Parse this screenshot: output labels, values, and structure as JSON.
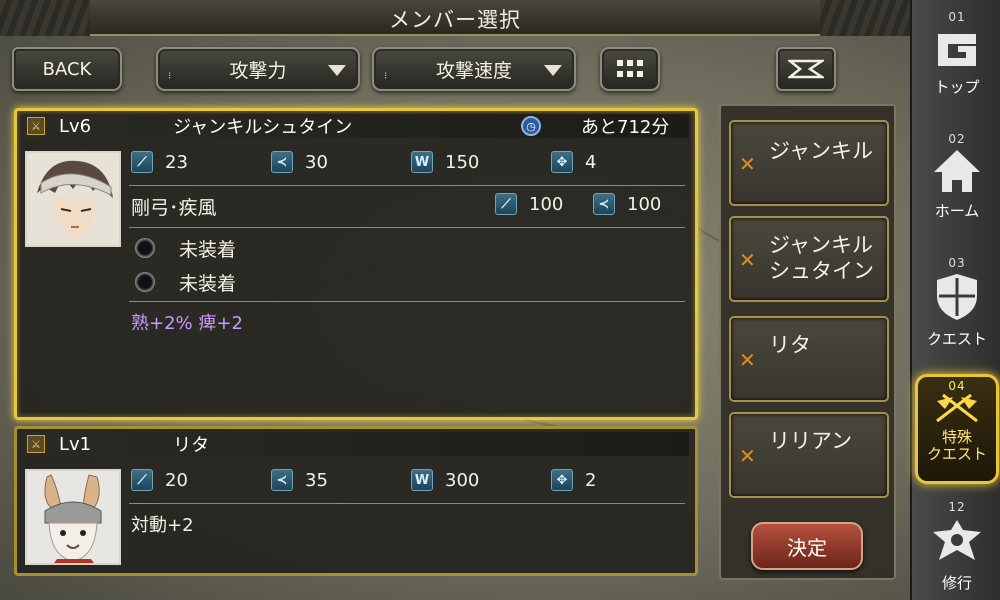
{
  "header": {
    "title": "メンバー選択"
  },
  "toolbar": {
    "back_label": "BACK",
    "sort_primary": "攻撃力",
    "sort_secondary": "攻撃速度"
  },
  "units": [
    {
      "level": "Lv6",
      "name": "ジャンキルシュタイン",
      "timer": "あと712分",
      "stats": [
        "23",
        "30",
        "150",
        "4"
      ],
      "skill_name": "剛弓･疾風",
      "skill_stats": [
        "100",
        "100"
      ],
      "equip": [
        "未装着",
        "未装着"
      ],
      "traits": "熟+2% 痺+2",
      "selected": true
    },
    {
      "level": "Lv1",
      "name": "リタ",
      "stats": [
        "20",
        "35",
        "300",
        "2"
      ],
      "traits": "対動+2",
      "selected": false
    }
  ],
  "party": {
    "slots": [
      "ジャンキル",
      "ジャンキル\nシュタイン",
      "リタ",
      "リリアン"
    ],
    "confirm_label": "決定"
  },
  "nav": [
    {
      "num": "01",
      "label": "トップ",
      "icon": "g-logo-icon"
    },
    {
      "num": "02",
      "label": "ホーム",
      "icon": "house-icon"
    },
    {
      "num": "03",
      "label": "クエスト",
      "icon": "shield-icon"
    },
    {
      "num": "04",
      "label": "特殊\nクエスト",
      "icon": "crossed-flags-icon",
      "active": true
    },
    {
      "num": "12",
      "label": "修行",
      "icon": "emblem-icon"
    }
  ],
  "colors": {
    "accent_gold": "#e8c739",
    "stat_icon": "#2f5c72",
    "trait_purple": "#c79bff",
    "confirm_red": "#9a3a28"
  }
}
